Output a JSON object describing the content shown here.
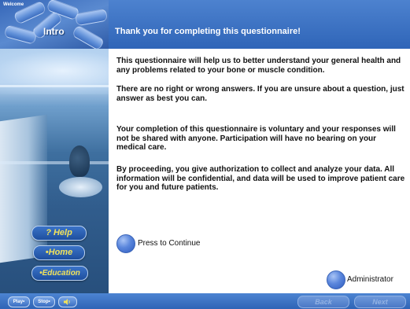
{
  "app": {
    "logo_text": "Welcome",
    "section_title": "Intro"
  },
  "header": {
    "title": "Thank you for completing this questionnaire!"
  },
  "content": {
    "paragraphs": [
      "This questionnaire will help us to better understand your general health and any problems related to your bone or muscle condition.",
      "There are no right or wrong answers.  If you are unsure about a question, just answer as best you can.",
      "Your completion of this questionnaire is voluntary and your responses will not be shared with anyone. Participation will have no bearing on your medical care.",
      "By proceeding, you give authorization to collect and analyze your data. All information will be confidential, and data will be used to improve patient care for you and future patients."
    ],
    "continue_label": "Press to Continue",
    "administrator_label": "Administrator"
  },
  "sidebar": {
    "help_label": "? Help",
    "home_label": "•Home",
    "education_label": "•Education"
  },
  "bottom_bar": {
    "play_label": "Play•",
    "stop_label": "Stop•",
    "speaker_icon": "speaker-icon",
    "back_label": "Back",
    "next_label": "Next"
  },
  "colors": {
    "header_blue": "#2f65b8",
    "nav_text_yellow": "#f1e25a",
    "button_blue": "#5a86dc"
  }
}
